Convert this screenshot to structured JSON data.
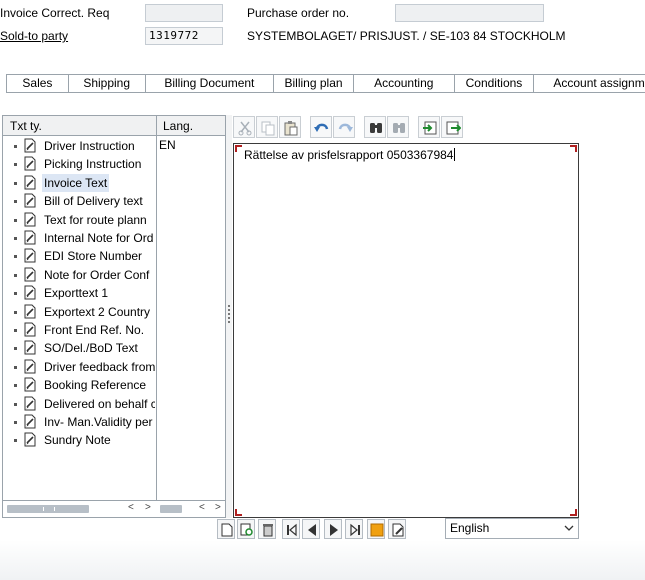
{
  "header": {
    "invoice_correct_label": "Invoice Correct. Req",
    "invoice_correct_value": "",
    "purchase_order_label": "Purchase order no.",
    "purchase_order_value": "",
    "sold_to_label": "Sold-to party",
    "sold_to_value": "1319772",
    "sold_to_name": "SYSTEMBOLAGET/ PRISJUST. / SE-103 84 STOCKHOLM"
  },
  "tabs": [
    {
      "label": "Sales"
    },
    {
      "label": "Shipping"
    },
    {
      "label": "Billing Document"
    },
    {
      "label": "Billing plan"
    },
    {
      "label": "Accounting"
    },
    {
      "label": "Conditions"
    },
    {
      "label": "Account assignm"
    }
  ],
  "text_types": {
    "col_txt_ty": "Txt ty.",
    "col_lang": "Lang.",
    "selected_lang": "EN",
    "items": [
      {
        "label": "Driver Instruction"
      },
      {
        "label": "Picking Instruction"
      },
      {
        "label": "Invoice Text"
      },
      {
        "label": "Bill of Delivery text"
      },
      {
        "label": "Text for route plann"
      },
      {
        "label": "Internal Note for Ord"
      },
      {
        "label": "EDI Store Number"
      },
      {
        "label": "Note for Order Conf"
      },
      {
        "label": "Exporttext 1"
      },
      {
        "label": "Exportext 2 Country"
      },
      {
        "label": "Front End Ref. No."
      },
      {
        "label": "SO/Del./BoD Text"
      },
      {
        "label": "Driver feedback from"
      },
      {
        "label": "Booking Reference"
      },
      {
        "label": "Delivered on behalf c"
      },
      {
        "label": "Inv- Man.Validity per"
      },
      {
        "label": "Sundry Note"
      }
    ],
    "selected_index": 2
  },
  "editor": {
    "text": "Rättelse av prisfelsrapport 0503367984"
  },
  "language_select": {
    "value": "English"
  },
  "icons": {
    "toolbar": [
      "cut-icon",
      "copy-icon",
      "paste-icon",
      "undo-icon",
      "redo-icon",
      "find-icon",
      "find-next-icon",
      "import-icon",
      "export-icon"
    ],
    "nav": [
      "new-document-icon",
      "detail-icon",
      "delete-icon",
      "first-icon",
      "previous-icon",
      "next-icon",
      "last-icon",
      "orange-square-icon",
      "edit-icon"
    ]
  }
}
